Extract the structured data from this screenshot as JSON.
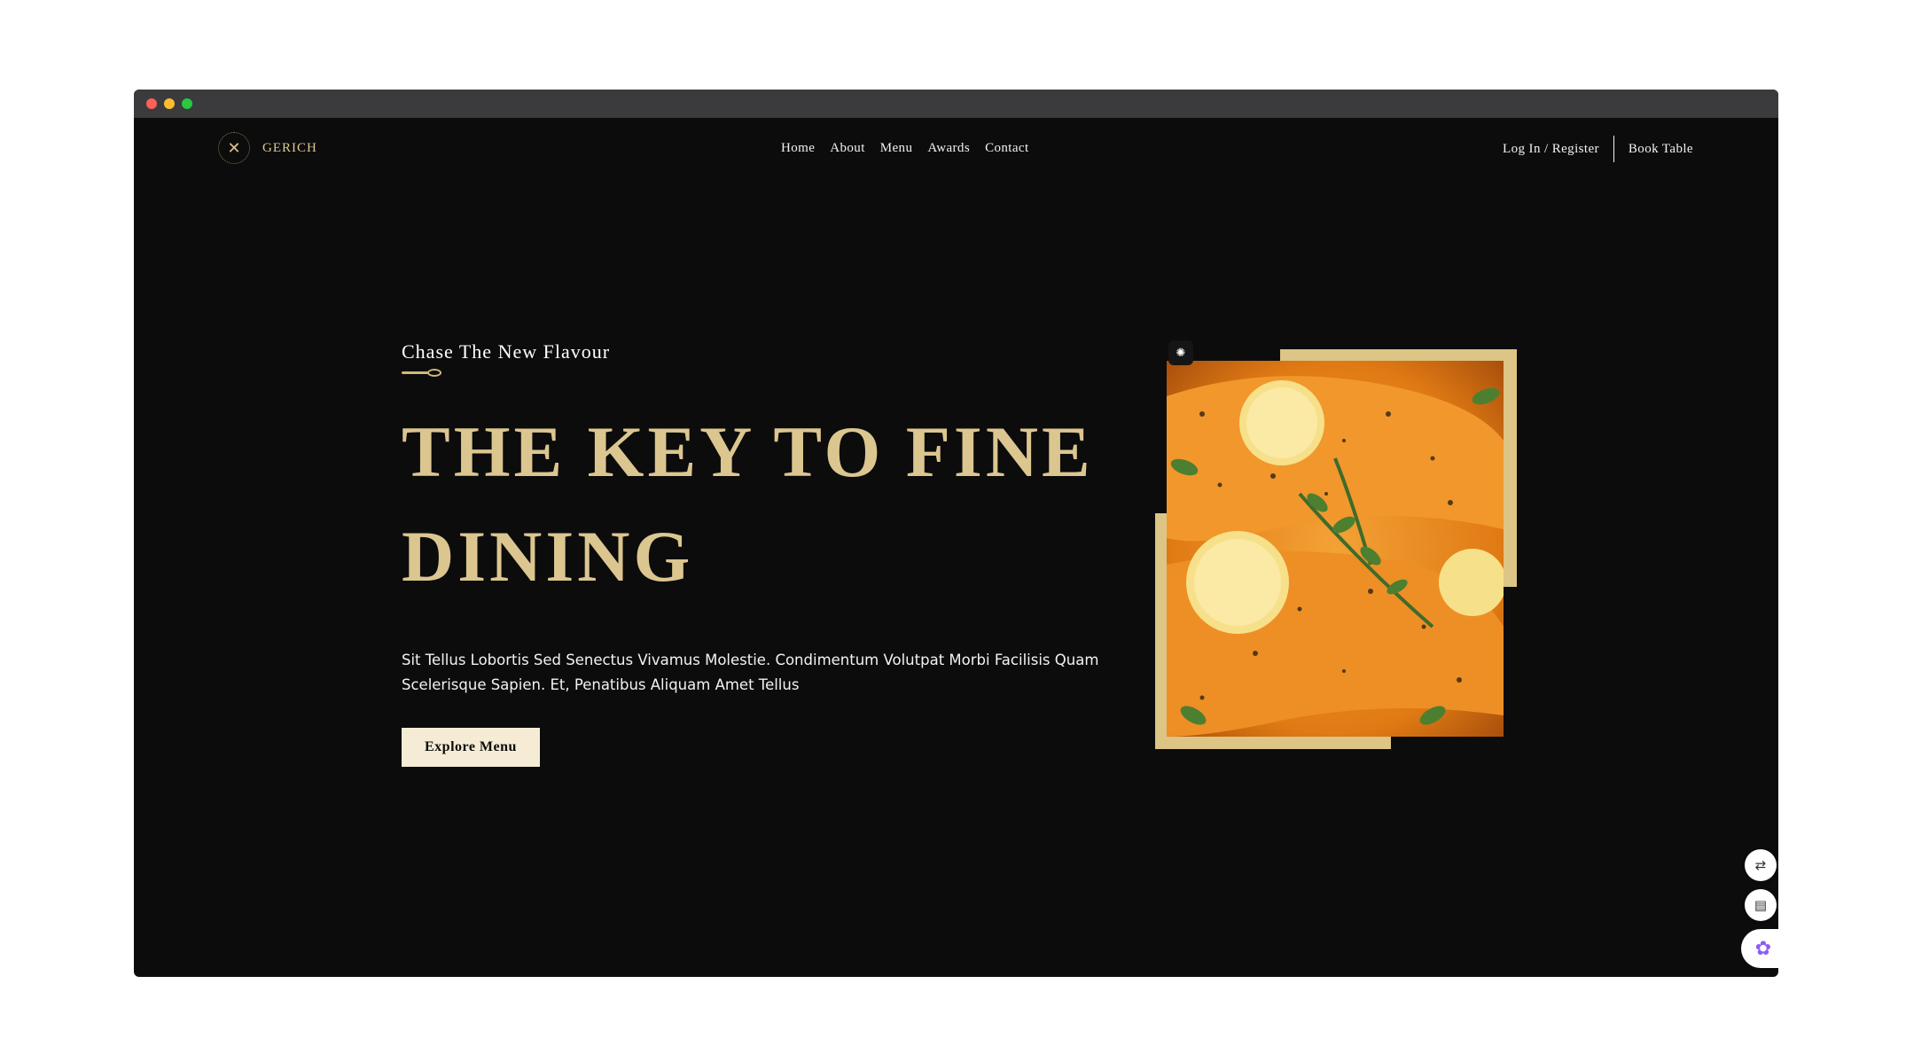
{
  "window": {
    "traffic_lights": [
      "close",
      "minimize",
      "maximize"
    ]
  },
  "nav": {
    "logo_text": "GERICH",
    "logo_icon": "crossed-fork-knife-icon",
    "menu": [
      {
        "label": "Home"
      },
      {
        "label": "About"
      },
      {
        "label": "Menu"
      },
      {
        "label": "Awards"
      },
      {
        "label": "Contact"
      }
    ],
    "login_label": "Log In / Register",
    "book_label": "Book Table"
  },
  "hero": {
    "subtitle": "Chase The New Flavour",
    "headline": "THE KEY TO FINE DINING",
    "description": "Sit Tellus Lobortis Sed Senectus Vivamus Molestie. Condimentum Volutpat Morbi Facilisis Quam Scelerisque Sapien. Et, Penatibus Aliquam Amet Tellus",
    "cta_label": "Explore Menu",
    "image_alt_icon": "salmon-with-lemon-image"
  },
  "side_tools": {
    "translate_icon": "translate-icon",
    "reader_icon": "book-icon",
    "ai_icon": "brain-icon"
  },
  "colors": {
    "background": "#0c0c0c",
    "gold": "#dcc690",
    "button_bg": "#f6ecd5",
    "titlebar": "#3b3b3d"
  }
}
